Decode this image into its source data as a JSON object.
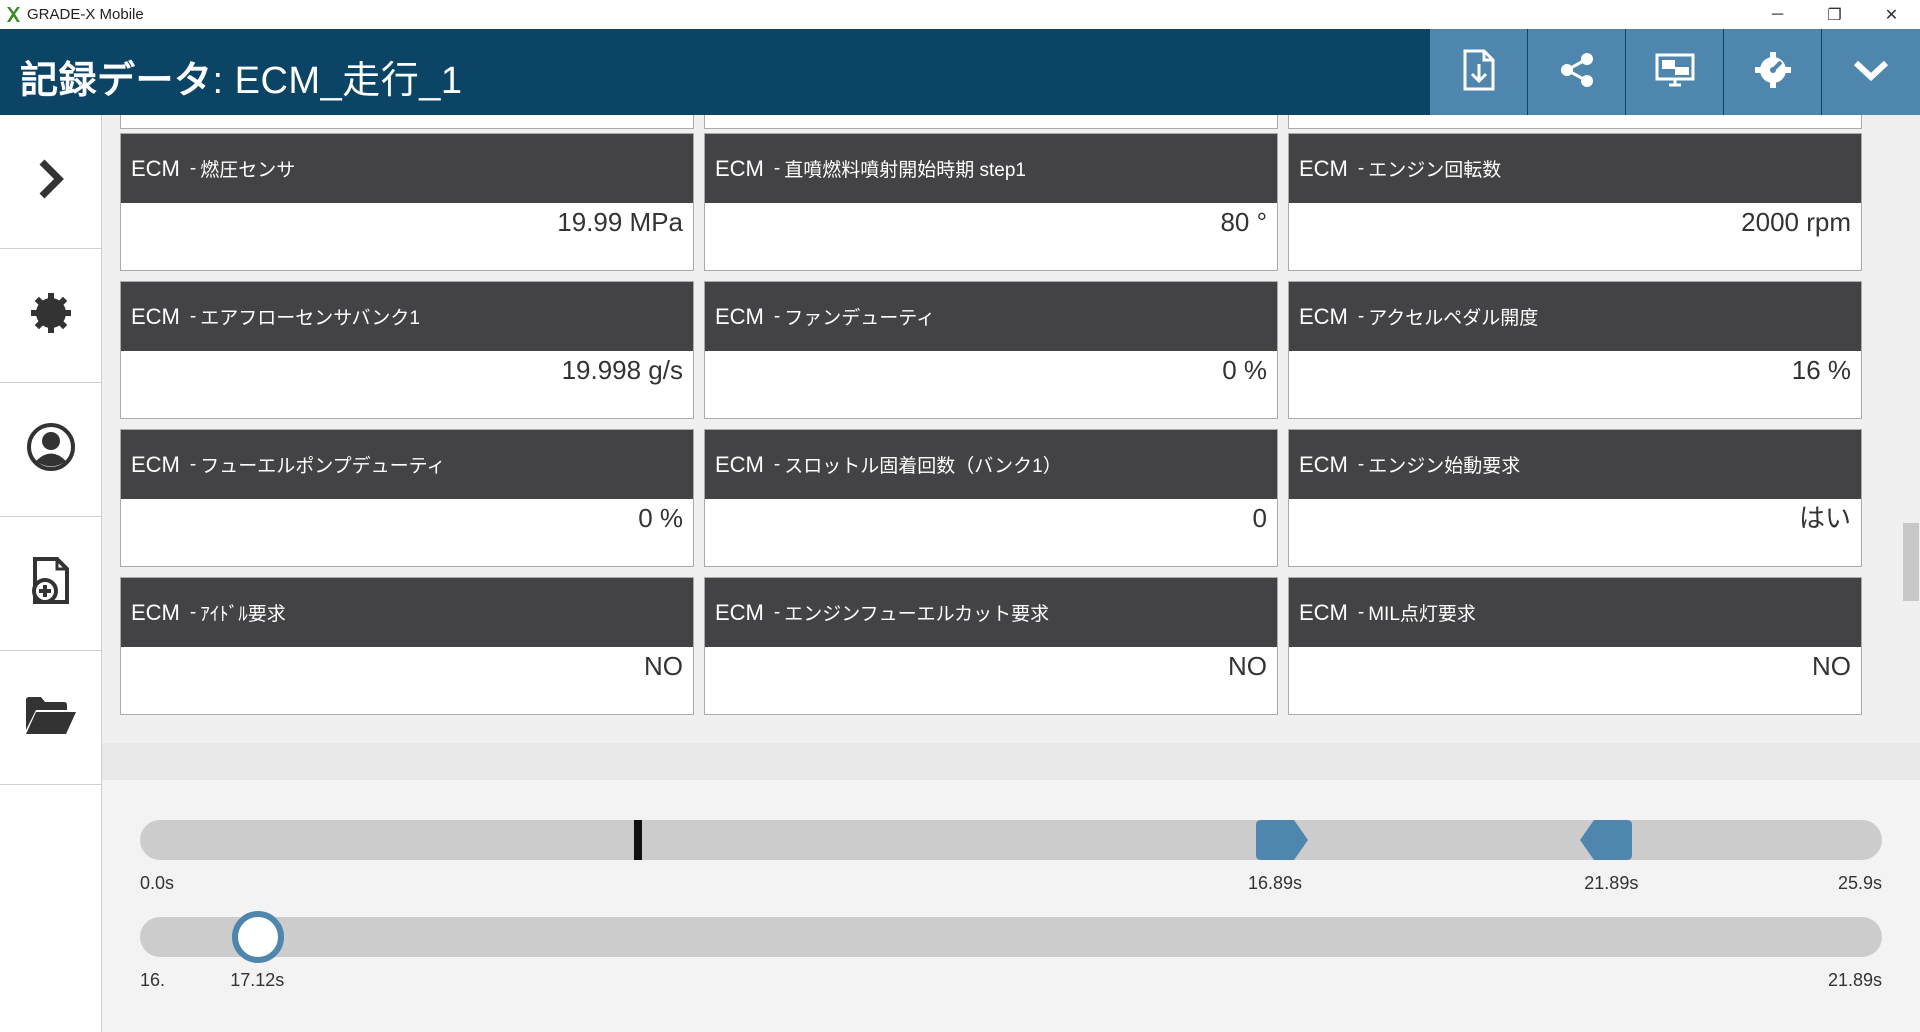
{
  "window": {
    "app_title": "GRADE-X Mobile",
    "minimize": "─",
    "maximize": "❐",
    "close": "✕"
  },
  "header": {
    "title_prefix": "記録データ",
    "title_rest": ": ECM_走行_1",
    "buttons": [
      "export-icon",
      "share-icon",
      "display-icon",
      "gauge-settings-icon",
      "chevron-down-icon"
    ]
  },
  "sidebar": {
    "items": [
      "chevron-right-icon",
      "gear-icon",
      "user-icon",
      "add-file-icon",
      "folder-open-icon"
    ]
  },
  "cards": [
    {
      "ecu": "ECM",
      "param": "燃圧センサ",
      "value": "19.99 MPa"
    },
    {
      "ecu": "ECM",
      "param": "直噴燃料噴射開始時期 step1",
      "value": "80 °"
    },
    {
      "ecu": "ECM",
      "param": "エンジン回転数",
      "value": "2000 rpm"
    },
    {
      "ecu": "ECM",
      "param": "エアフローセンサバンク1",
      "value": "19.998 g/s"
    },
    {
      "ecu": "ECM",
      "param": "ファンデューティ",
      "value": "0 %"
    },
    {
      "ecu": "ECM",
      "param": "アクセルペダル開度",
      "value": "16 %"
    },
    {
      "ecu": "ECM",
      "param": "フューエルポンプデューティ",
      "value": "0 %"
    },
    {
      "ecu": "ECM",
      "param": "スロットル固着回数（バンク1）",
      "value": "0"
    },
    {
      "ecu": "ECM",
      "param": "エンジン始動要求",
      "value": "はい"
    },
    {
      "ecu": "ECM",
      "param": "ｱｲﾄﾞﾙ要求",
      "value": "NO"
    },
    {
      "ecu": "ECM",
      "param": "エンジンフューエルカット要求",
      "value": "NO"
    },
    {
      "ecu": "ECM",
      "param": "MIL点灯要求",
      "value": "NO"
    }
  ],
  "timeline": {
    "overview": {
      "start_label": "0.0s",
      "end_label": "25.9s",
      "range_start_label": "16.89s",
      "range_end_label": "21.89s",
      "total": 25.9,
      "range_start": 16.89,
      "range_end": 21.89,
      "cursor": 7.4
    },
    "detail": {
      "start_label": "16.",
      "current_label": "17.12s",
      "end_label": "21.89s",
      "start": 16.89,
      "end": 21.89,
      "current": 17.12
    }
  },
  "colors": {
    "header_bg": "#0c4466",
    "button_bg": "#4f86ad",
    "card_head": "#434345",
    "accent": "#4f86ad"
  }
}
